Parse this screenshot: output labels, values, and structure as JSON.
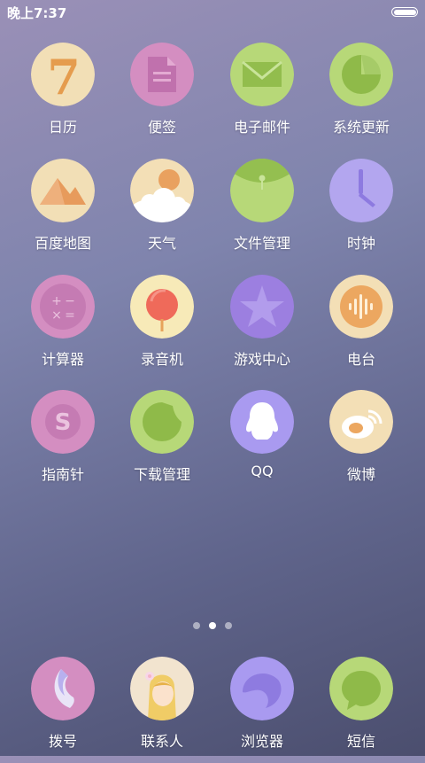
{
  "status": {
    "time": "晚上7:37",
    "battery_level": 1.0
  },
  "apps": [
    {
      "label": "日历",
      "icon": "calendar-icon"
    },
    {
      "label": "便签",
      "icon": "notes-icon"
    },
    {
      "label": "电子邮件",
      "icon": "email-icon"
    },
    {
      "label": "系统更新",
      "icon": "system-update-icon"
    },
    {
      "label": "百度地图",
      "icon": "baidu-map-icon"
    },
    {
      "label": "天气",
      "icon": "weather-icon"
    },
    {
      "label": "文件管理",
      "icon": "file-manager-icon"
    },
    {
      "label": "时钟",
      "icon": "clock-icon"
    },
    {
      "label": "计算器",
      "icon": "calculator-icon"
    },
    {
      "label": "录音机",
      "icon": "recorder-icon"
    },
    {
      "label": "游戏中心",
      "icon": "game-center-icon"
    },
    {
      "label": "电台",
      "icon": "radio-icon"
    },
    {
      "label": "指南针",
      "icon": "compass-icon"
    },
    {
      "label": "下载管理",
      "icon": "download-manager-icon"
    },
    {
      "label": "QQ",
      "icon": "qq-icon"
    },
    {
      "label": "微博",
      "icon": "weibo-icon"
    }
  ],
  "pager": {
    "pages": 3,
    "current": 2
  },
  "dock": [
    {
      "label": "拨号",
      "icon": "phone-dialer-icon"
    },
    {
      "label": "联系人",
      "icon": "contacts-icon"
    },
    {
      "label": "浏览器",
      "icon": "browser-icon"
    },
    {
      "label": "短信",
      "icon": "messages-icon"
    }
  ],
  "calendar_day": "7"
}
